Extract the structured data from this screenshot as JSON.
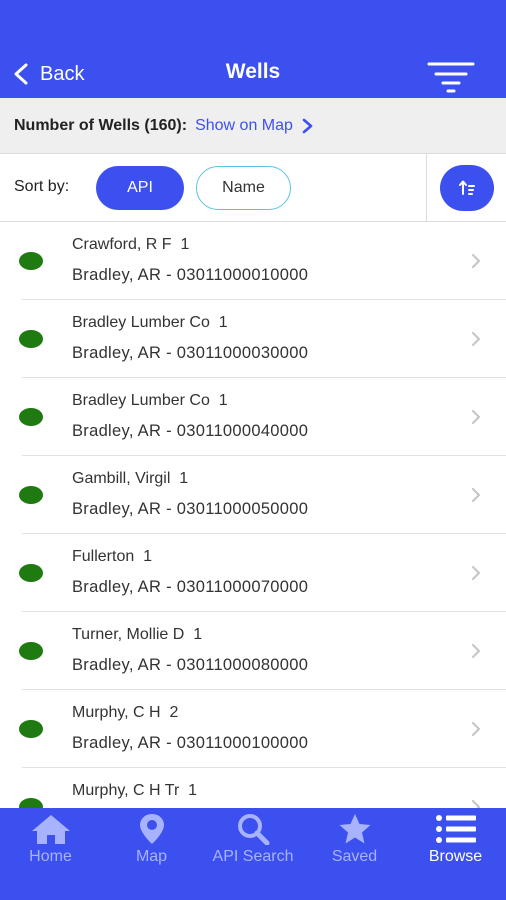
{
  "nav": {
    "back_label": "Back",
    "title": "Wells",
    "filter_icon": "filter-lines-icon"
  },
  "summary": {
    "count_label": "Number of Wells (160):",
    "show_map_label": "Show on Map"
  },
  "sort": {
    "label": "Sort by:",
    "options": [
      "API",
      "Name"
    ],
    "selected": "API",
    "toggle_icon": "sort-order-icon"
  },
  "wells": [
    {
      "name": "Crawford, R F  1",
      "location": "Bradley, AR - 03011000010000",
      "status_color": "#1f7a12"
    },
    {
      "name": "Bradley Lumber Co  1",
      "location": "Bradley, AR - 03011000030000",
      "status_color": "#1f7a12"
    },
    {
      "name": "Bradley Lumber Co  1",
      "location": "Bradley, AR - 03011000040000",
      "status_color": "#1f7a12"
    },
    {
      "name": "Gambill, Virgil  1",
      "location": "Bradley, AR - 03011000050000",
      "status_color": "#1f7a12"
    },
    {
      "name": "Fullerton  1",
      "location": "Bradley, AR - 03011000070000",
      "status_color": "#1f7a12"
    },
    {
      "name": "Turner, Mollie D  1",
      "location": "Bradley, AR - 03011000080000",
      "status_color": "#1f7a12"
    },
    {
      "name": "Murphy, C H  2",
      "location": "Bradley, AR - 03011000100000",
      "status_color": "#1f7a12"
    },
    {
      "name": "Murphy, C H Tr  1",
      "location": "",
      "status_color": "#1f7a12"
    }
  ],
  "tabs": [
    {
      "label": "Home",
      "icon": "home-icon",
      "active": false
    },
    {
      "label": "Map",
      "icon": "map-pin-icon",
      "active": false
    },
    {
      "label": "API Search",
      "icon": "search-icon",
      "active": false
    },
    {
      "label": "Saved",
      "icon": "star-icon",
      "active": false
    },
    {
      "label": "Browse",
      "icon": "list-icon",
      "active": true
    }
  ],
  "colors": {
    "brand": "#3c50f0",
    "well_status": "#1f7a12",
    "tab_inactive": "#a8b3ff"
  }
}
